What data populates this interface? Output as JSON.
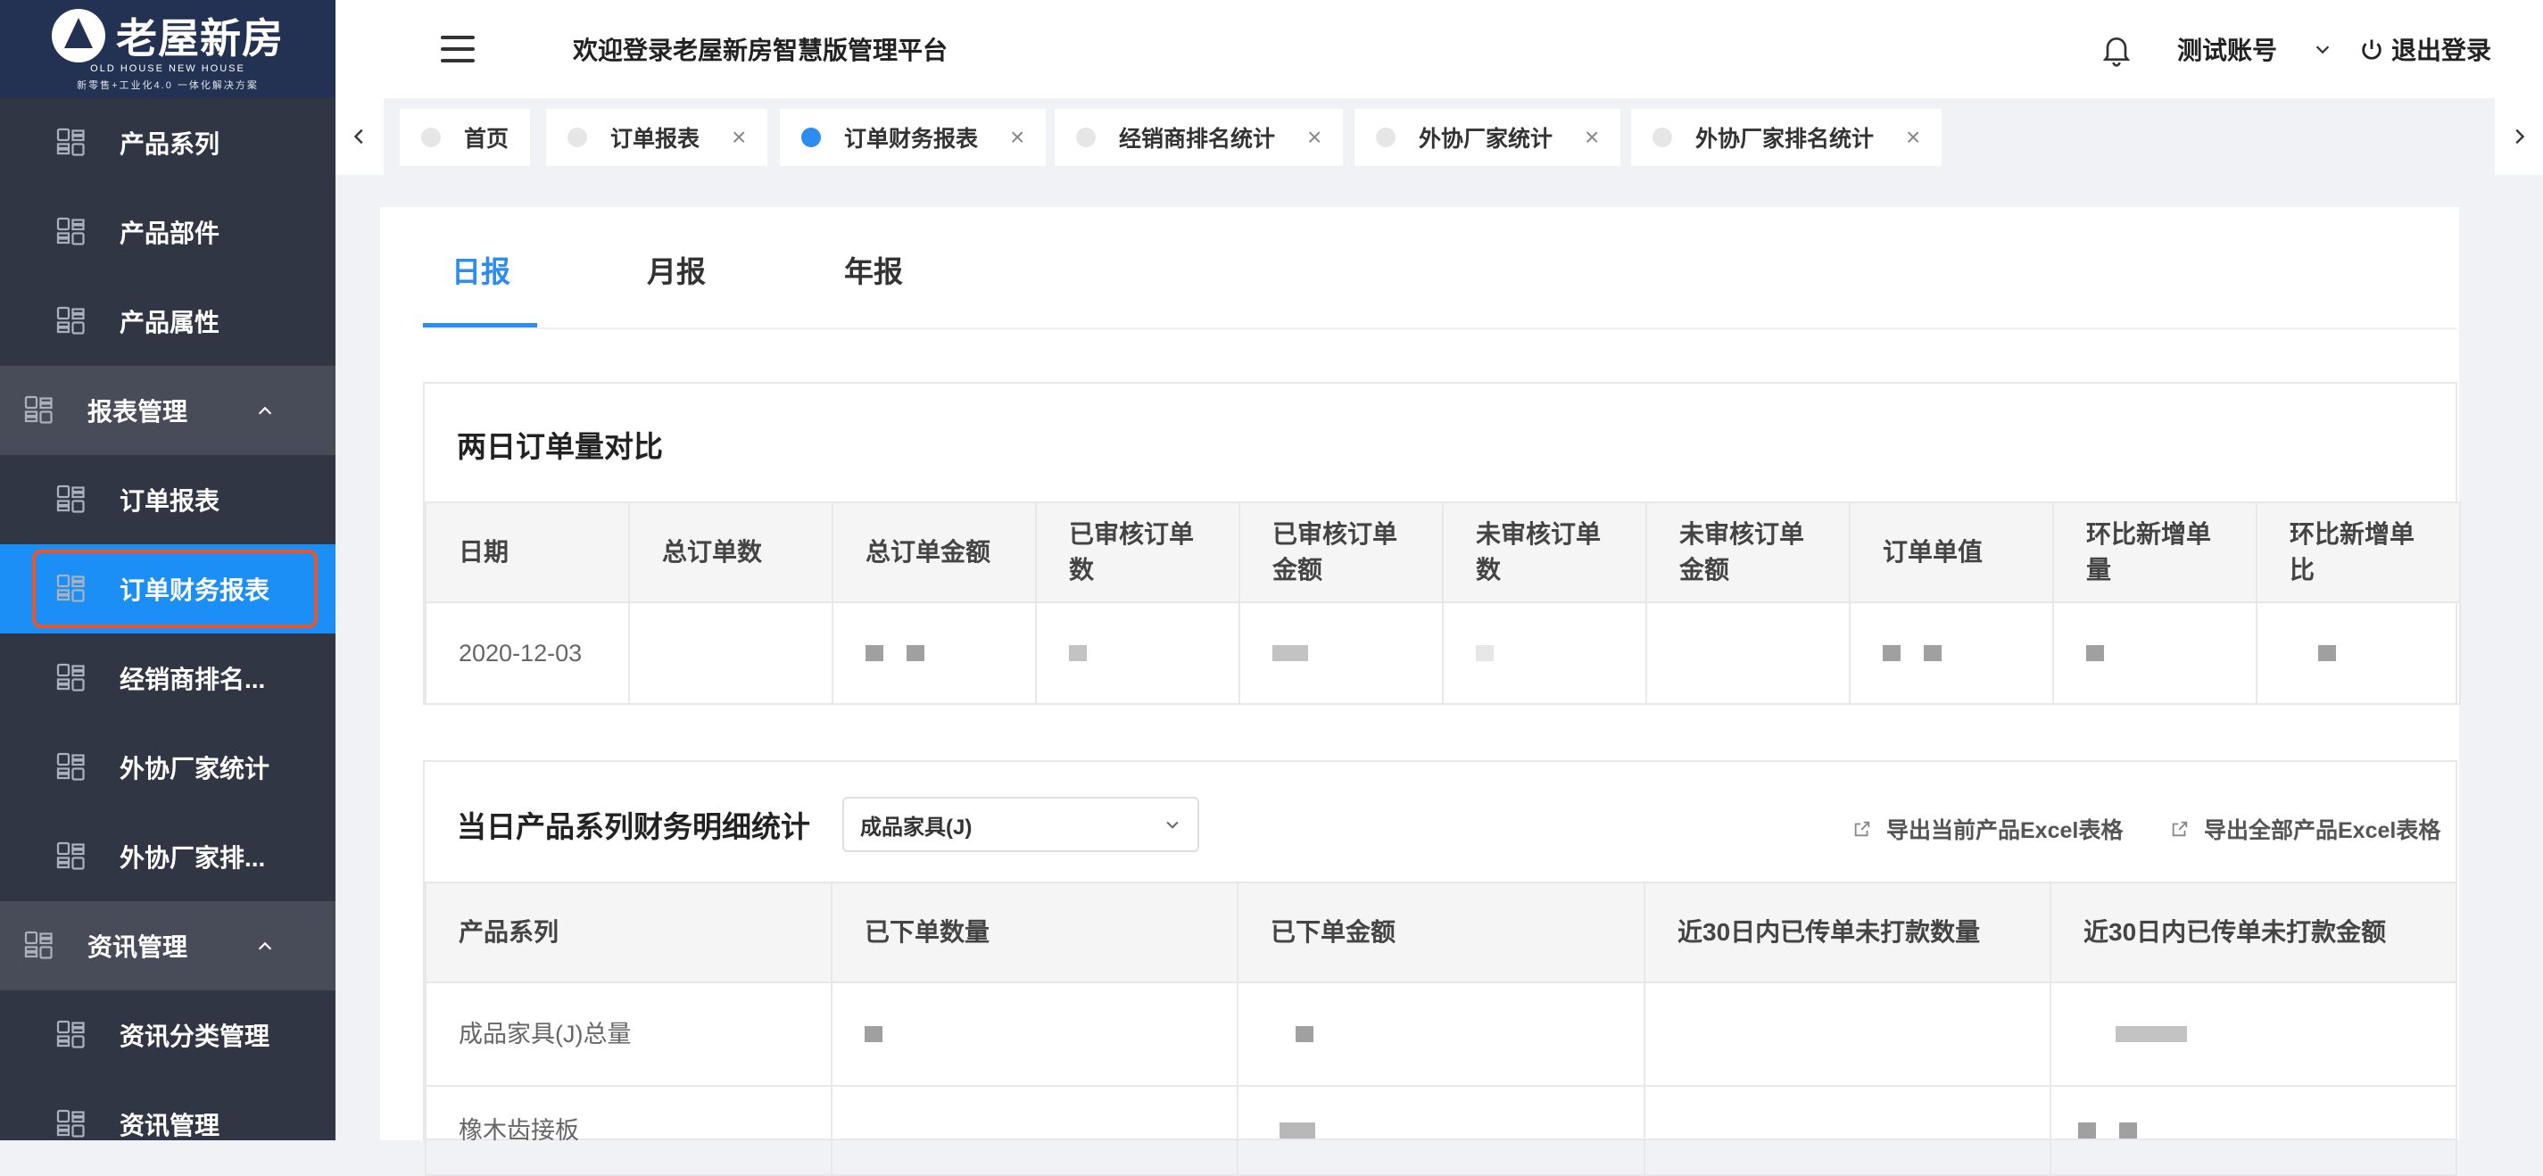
{
  "app": {
    "logo_text": "老屋新房",
    "logo_sub1": "OLD HOUSE NEW HOUSE",
    "logo_sub2": "新零售+工业化4.0 一体化解决方案",
    "welcome": "欢迎登录老屋新房智慧版管理平台",
    "account": "测试账号",
    "logout": "退出登录"
  },
  "sidebar": {
    "items": [
      {
        "label": "产品系列",
        "type": "sub"
      },
      {
        "label": "产品部件",
        "type": "sub"
      },
      {
        "label": "产品属性",
        "type": "sub"
      },
      {
        "label": "报表管理",
        "type": "group"
      },
      {
        "label": "订单报表",
        "type": "sub"
      },
      {
        "label": "订单财务报表",
        "type": "sub",
        "active": true
      },
      {
        "label": "经销商排名...",
        "type": "sub"
      },
      {
        "label": "外协厂家统计",
        "type": "sub"
      },
      {
        "label": "外协厂家排...",
        "type": "sub"
      },
      {
        "label": "资讯管理",
        "type": "group"
      },
      {
        "label": "资讯分类管理",
        "type": "sub"
      },
      {
        "label": "资讯管理",
        "type": "sub"
      }
    ]
  },
  "tabs": [
    {
      "label": "首页",
      "closable": false
    },
    {
      "label": "订单报表",
      "closable": true
    },
    {
      "label": "订单财务报表",
      "closable": true,
      "active": true
    },
    {
      "label": "经销商排名统计",
      "closable": true
    },
    {
      "label": "外协厂家统计",
      "closable": true
    },
    {
      "label": "外协厂家排名统计",
      "closable": true
    }
  ],
  "report_tabs": [
    "日报",
    "月报",
    "年报"
  ],
  "compare": {
    "title": "两日订单量对比",
    "headers": [
      "日期",
      "总订单数",
      "总订单金额",
      "已审核订单数",
      "已审核订单金额",
      "未审核订单数",
      "未审核订单金额",
      "订单单值",
      "环比新增单量",
      "环比新增单比"
    ],
    "row": [
      "2020-12-03",
      "",
      "",
      "",
      "",
      "",
      "",
      "",
      "",
      ""
    ]
  },
  "detail": {
    "title": "当日产品系列财务明细统计",
    "select_value": "成品家具(J)",
    "export_current": "导出当前产品Excel表格",
    "export_all": "导出全部产品Excel表格",
    "headers": [
      "产品系列",
      "已下单数量",
      "已下单金额",
      "近30日内已传单未打款数量",
      "近30日内已传单未打款金额"
    ],
    "rows": [
      [
        "成品家具(J)总量",
        "",
        "",
        "",
        ""
      ],
      [
        "橡木齿接板",
        "",
        "",
        "",
        ""
      ]
    ]
  },
  "colors": {
    "sidebar_bg": "#303643",
    "active_blue": "#1b8ff5",
    "accent": "#2d8cf0",
    "highlight_border": "#e8562c"
  }
}
